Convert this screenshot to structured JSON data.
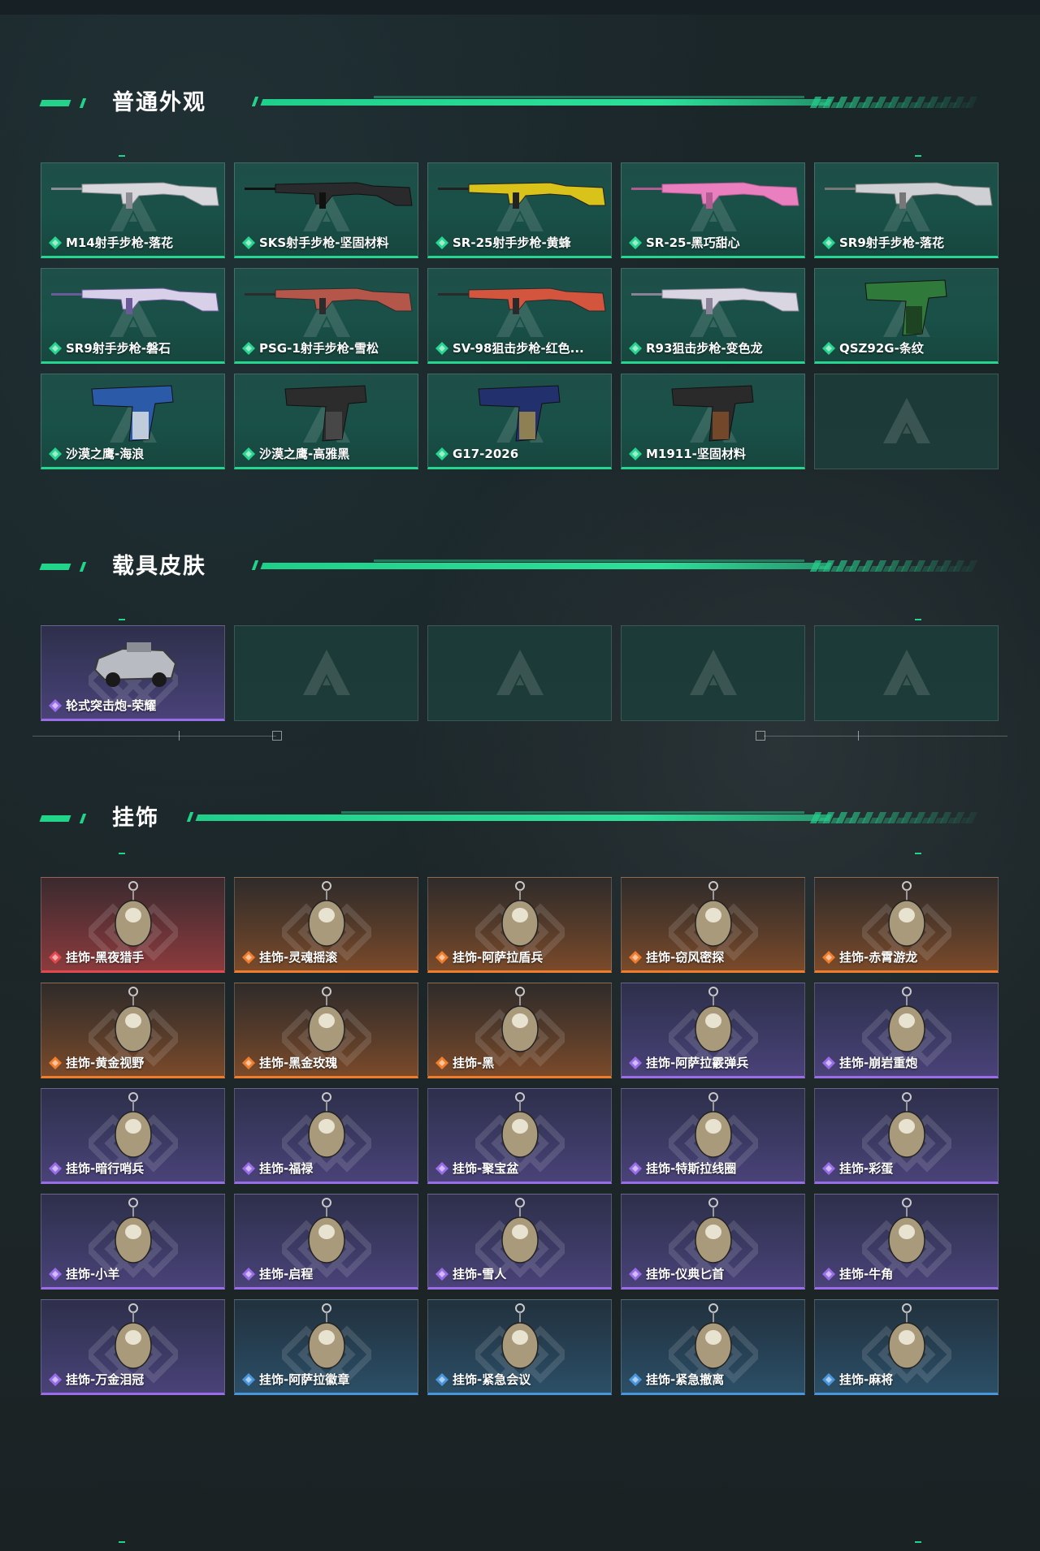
{
  "sections": [
    {
      "title": "普通外观",
      "items": [
        {
          "label": "M14射手步枪-落花",
          "rarity": "green",
          "icon": "rifle-icon",
          "art": "rifle-white"
        },
        {
          "label": "SKS射手步枪-坚固材料",
          "rarity": "green",
          "icon": "rifle-icon",
          "art": "rifle-black"
        },
        {
          "label": "SR-25射手步枪-黄蜂",
          "rarity": "green",
          "icon": "rifle-icon",
          "art": "rifle-yellow"
        },
        {
          "label": "SR-25-黑巧甜心",
          "rarity": "green",
          "icon": "rifle-icon",
          "art": "rifle-pink"
        },
        {
          "label": "SR9射手步枪-落花",
          "rarity": "green",
          "icon": "rifle-icon",
          "art": "rifle-silver"
        },
        {
          "label": "SR9射手步枪-磐石",
          "rarity": "green",
          "icon": "rifle-icon",
          "art": "rifle-camo"
        },
        {
          "label": "PSG-1射手步枪-雪松",
          "rarity": "green",
          "icon": "rifle-icon",
          "art": "rifle-red"
        },
        {
          "label": "SV-98狙击步枪-红色...",
          "rarity": "green",
          "icon": "rifle-icon",
          "art": "rifle-orange"
        },
        {
          "label": "R93狙击步枪-变色龙",
          "rarity": "green",
          "icon": "rifle-icon",
          "art": "rifle-pale"
        },
        {
          "label": "QSZ92G-条纹",
          "rarity": "green",
          "icon": "pistol-icon",
          "art": "pistol-green"
        },
        {
          "label": "沙漠之鹰-海浪",
          "rarity": "green",
          "icon": "pistol-icon",
          "art": "pistol-blue"
        },
        {
          "label": "沙漠之鹰-高雅黑",
          "rarity": "green",
          "icon": "pistol-icon",
          "art": "pistol-black"
        },
        {
          "label": "G17-2026",
          "rarity": "green",
          "icon": "pistol-icon",
          "art": "pistol-navy"
        },
        {
          "label": "M1911-坚固材料",
          "rarity": "green",
          "icon": "pistol-icon",
          "art": "pistol-wood"
        }
      ],
      "empty_slots": 1
    },
    {
      "title": "载具皮肤",
      "items": [
        {
          "label": "轮式突击炮-荣耀",
          "rarity": "purple",
          "icon": "vehicle-icon",
          "art": "vehicle"
        }
      ],
      "empty_slots": 4
    },
    {
      "title": "挂饰",
      "items": [
        {
          "label": "挂饰-黑夜猎手",
          "rarity": "red",
          "icon": "charm-icon",
          "art": "charm"
        },
        {
          "label": "挂饰-灵魂摇滚",
          "rarity": "orange",
          "icon": "charm-icon",
          "art": "charm"
        },
        {
          "label": "挂饰-阿萨拉盾兵",
          "rarity": "orange",
          "icon": "charm-icon",
          "art": "charm"
        },
        {
          "label": "挂饰-窃风密探",
          "rarity": "orange",
          "icon": "charm-icon",
          "art": "charm"
        },
        {
          "label": "挂饰-赤霄游龙",
          "rarity": "orange",
          "icon": "charm-icon",
          "art": "charm"
        },
        {
          "label": "挂饰-黄金视野",
          "rarity": "orange",
          "icon": "charm-icon",
          "art": "charm"
        },
        {
          "label": "挂饰-黑金玫瑰",
          "rarity": "orange",
          "icon": "charm-icon",
          "art": "charm"
        },
        {
          "label": "挂饰-黑",
          "rarity": "orange",
          "icon": "charm-icon",
          "art": "charm"
        },
        {
          "label": "挂饰-阿萨拉霰弹兵",
          "rarity": "purple",
          "icon": "charm-icon",
          "art": "charm"
        },
        {
          "label": "挂饰-崩岩重炮",
          "rarity": "purple",
          "icon": "charm-icon",
          "art": "charm"
        },
        {
          "label": "挂饰-暗行哨兵",
          "rarity": "purple",
          "icon": "charm-icon",
          "art": "charm"
        },
        {
          "label": "挂饰-福禄",
          "rarity": "purple",
          "icon": "charm-icon",
          "art": "charm"
        },
        {
          "label": "挂饰-聚宝盆",
          "rarity": "purple",
          "icon": "charm-icon",
          "art": "charm"
        },
        {
          "label": "挂饰-特斯拉线圈",
          "rarity": "purple",
          "icon": "charm-icon",
          "art": "charm"
        },
        {
          "label": "挂饰-彩蛋",
          "rarity": "purple",
          "icon": "charm-icon",
          "art": "charm"
        },
        {
          "label": "挂饰-小羊",
          "rarity": "purple",
          "icon": "charm-icon",
          "art": "charm"
        },
        {
          "label": "挂饰-启程",
          "rarity": "purple",
          "icon": "charm-icon",
          "art": "charm"
        },
        {
          "label": "挂饰-雪人",
          "rarity": "purple",
          "icon": "charm-icon",
          "art": "charm"
        },
        {
          "label": "挂饰-仪典匕首",
          "rarity": "purple",
          "icon": "charm-icon",
          "art": "charm"
        },
        {
          "label": "挂饰-牛角",
          "rarity": "purple",
          "icon": "charm-icon",
          "art": "charm"
        },
        {
          "label": "挂饰-万金泪冠",
          "rarity": "purple",
          "icon": "charm-icon",
          "art": "charm"
        },
        {
          "label": "挂饰-阿萨拉徽章",
          "rarity": "blue",
          "icon": "charm-icon",
          "art": "charm"
        },
        {
          "label": "挂饰-紧急会议",
          "rarity": "blue",
          "icon": "charm-icon",
          "art": "charm"
        },
        {
          "label": "挂饰-紧急撤离",
          "rarity": "blue",
          "icon": "charm-icon",
          "art": "charm"
        },
        {
          "label": "挂饰-麻将",
          "rarity": "blue",
          "icon": "charm-icon",
          "art": "charm"
        }
      ],
      "empty_slots": 0
    }
  ],
  "colors": {
    "accent": "#21d48a",
    "rarity_green": "#26d58f",
    "rarity_purple": "#9a6de8",
    "rarity_orange": "#ef7d2c",
    "rarity_red": "#e2484d",
    "rarity_blue": "#4a96dc"
  }
}
